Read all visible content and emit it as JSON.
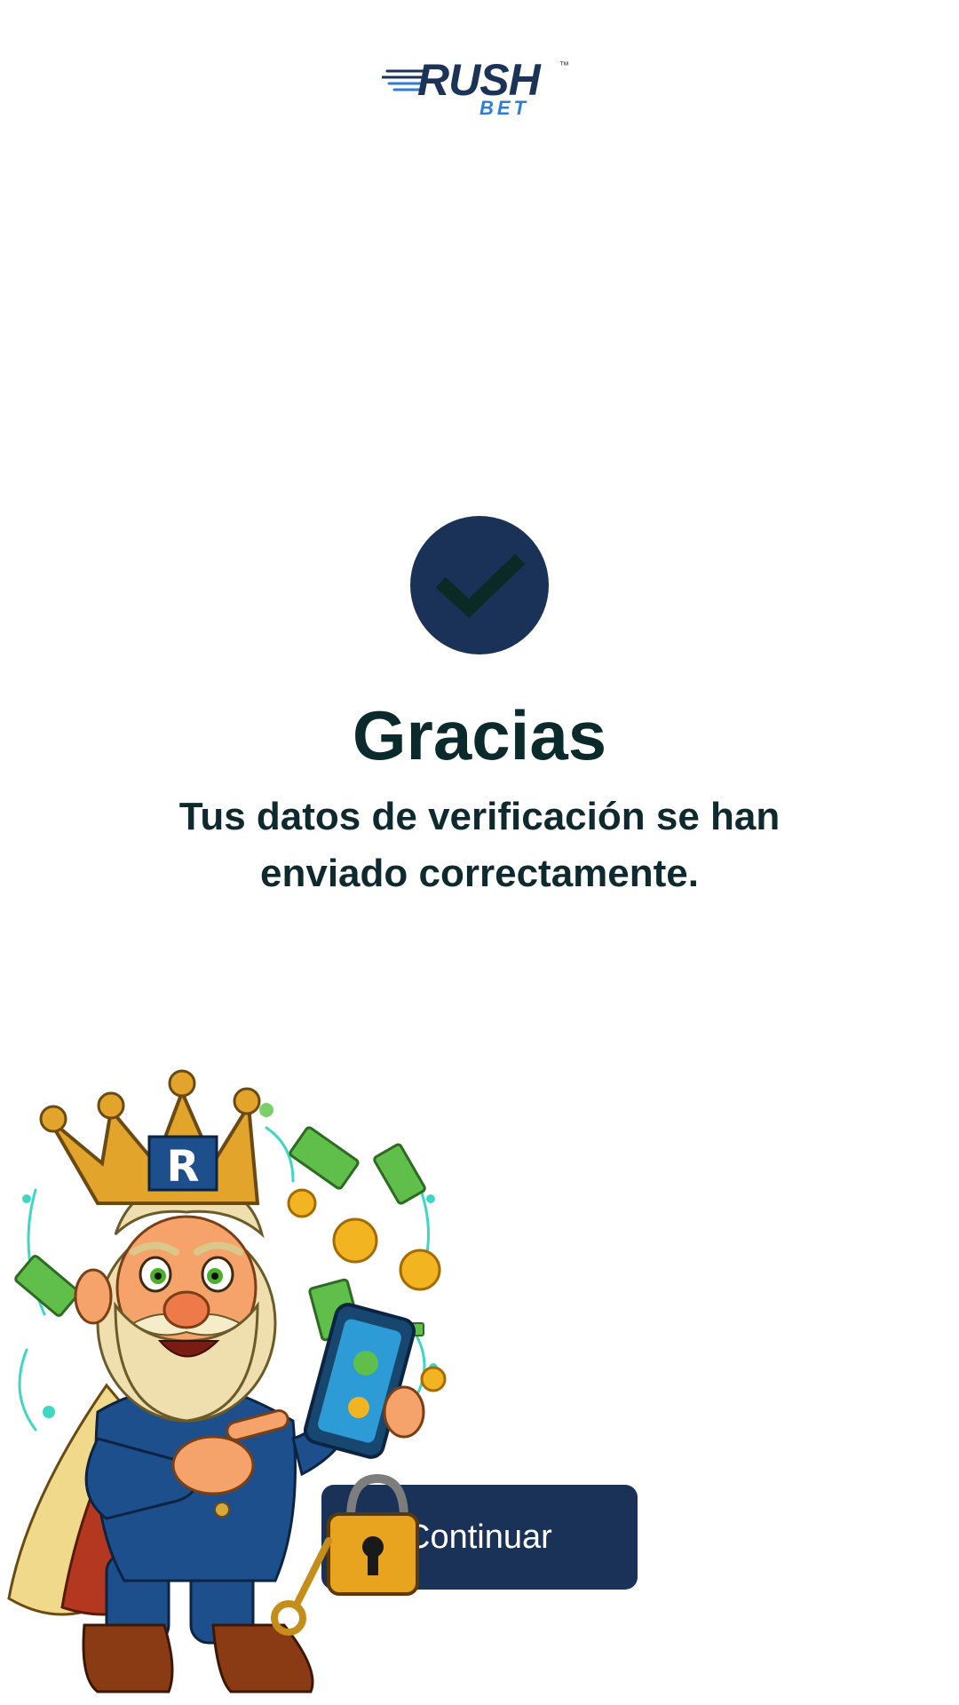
{
  "logo": {
    "name": "RUSH",
    "sub": "BET",
    "trademark": "™",
    "colors": {
      "primary": "#1b3357",
      "secondary": "#2e7ed8"
    }
  },
  "success": {
    "icon": "checkmark-icon",
    "title": "Gracias",
    "message": "Tus datos de verificación se han enviado correctamente."
  },
  "button": {
    "label": "Continuar",
    "color": "#1a3258"
  },
  "mascot": {
    "icon": "king-mascot-illustration",
    "crown_letter": "R"
  },
  "colors": {
    "accent": "#1a3258",
    "text": "#0b2a2c",
    "background": "#ffffff"
  }
}
